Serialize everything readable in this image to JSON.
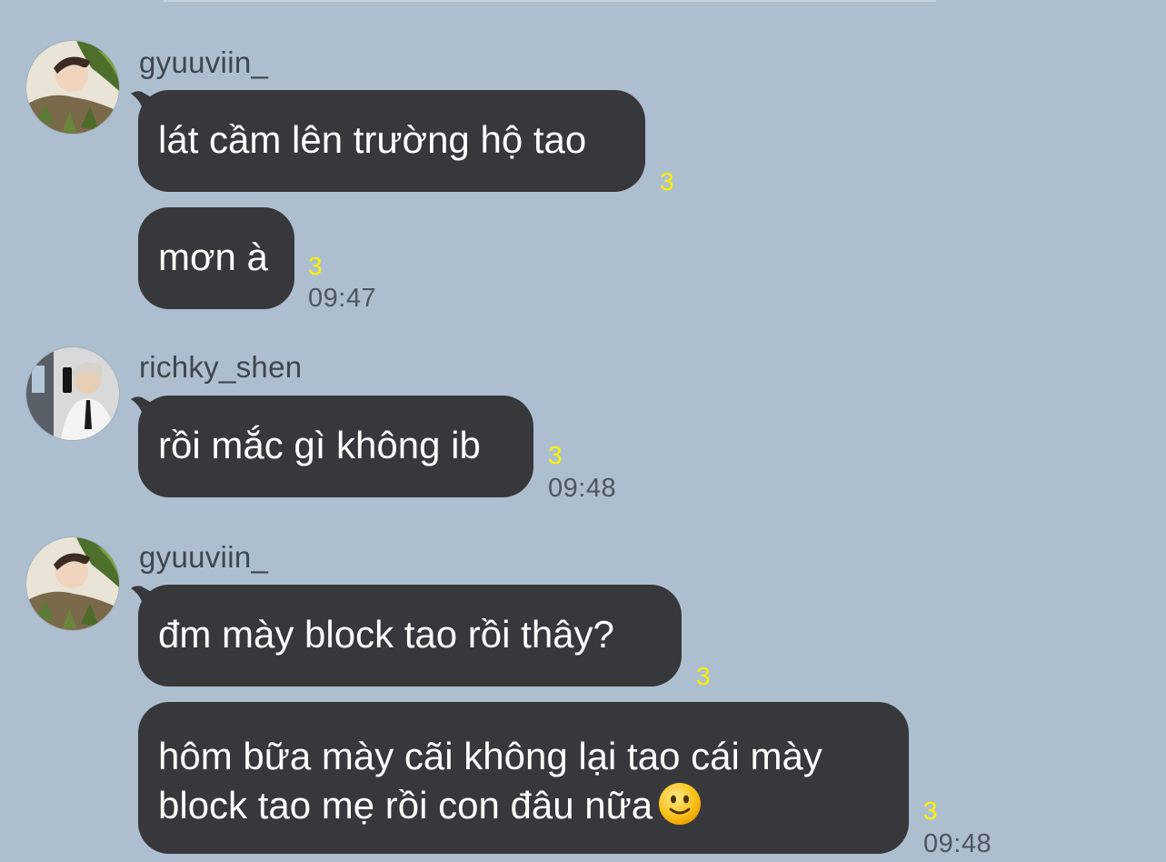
{
  "chat": {
    "messages": [
      {
        "sender": "gyuuviin_",
        "avatar_icon": "user-avatar-photo-icon",
        "bubbles": [
          {
            "text": "lát cầm lên trường hộ tao",
            "unread": "3",
            "time": ""
          },
          {
            "text": "mơn à",
            "unread": "3",
            "time": "09:47"
          }
        ]
      },
      {
        "sender": "richky_shen",
        "avatar_icon": "user-avatar-photo-icon",
        "bubbles": [
          {
            "text": "rồi mắc gì không ib",
            "unread": "3",
            "time": "09:48"
          }
        ]
      },
      {
        "sender": "gyuuviin_",
        "avatar_icon": "user-avatar-photo-icon",
        "bubbles": [
          {
            "text": "đm mày block tao rồi thây?",
            "unread": "3",
            "time": ""
          },
          {
            "lines": [
              "hôm bữa mày cãi không lại tao cái mày",
              "block tao mẹ rồi con đâu nữa"
            ],
            "emoji": "slightly-smiling-face-icon",
            "unread": "3",
            "time": "09:48"
          }
        ]
      }
    ]
  },
  "colors": {
    "background": "#adbfcf",
    "bubble": "#37383b",
    "bubble_text": "#ffffff",
    "unread_count": "#fff000",
    "sender_name": "#3d4650",
    "timestamp": "#4d5660"
  }
}
